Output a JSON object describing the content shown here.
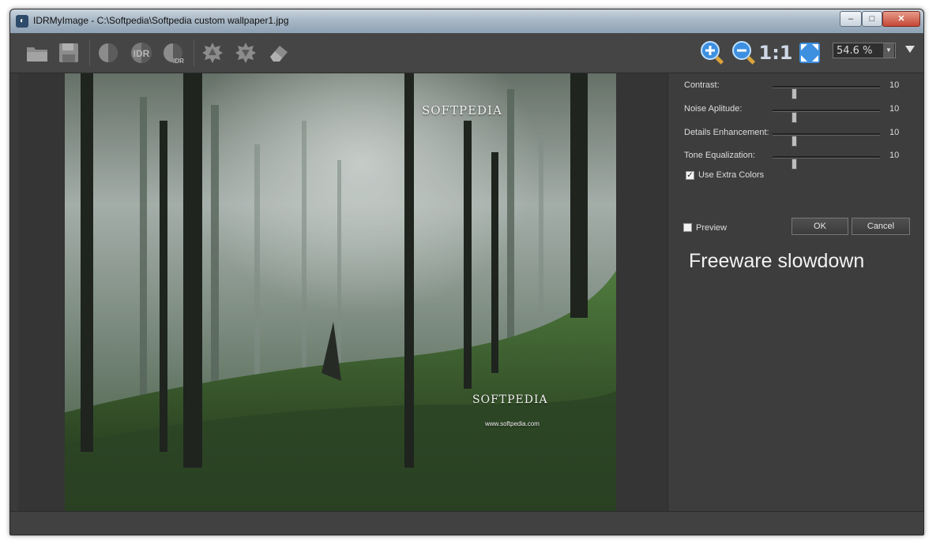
{
  "window": {
    "title": "IDRMyImage - C:\\Softpedia\\Softpedia custom wallpaper1.jpg",
    "minimize_label": "‒",
    "maximize_label": "□",
    "close_label": "✕"
  },
  "toolbar": {
    "idr_label": "IDR",
    "idr_small_label": "IDR",
    "one_to_one_label": "1:1",
    "zoom_value": "54.6 %"
  },
  "photo": {
    "watermark_top": "SOFTPEDIA",
    "watermark_mid": "SOFTPEDIA",
    "watermark_url": "www.softpedia.com"
  },
  "panel": {
    "sliders": [
      {
        "label": "Contrast:",
        "value": "10",
        "level": 0.2
      },
      {
        "label": "Noise Aplitude:",
        "value": "10",
        "level": 0.2
      },
      {
        "label": "Details Enhancement:",
        "value": "10",
        "level": 0.2
      },
      {
        "label": "Tone Equalization:",
        "value": "10",
        "level": 0.2
      }
    ],
    "use_extra_colors_label": "Use Extra Colors",
    "use_extra_colors_checked": true,
    "preview_label": "Preview",
    "preview_checked": false,
    "ok_label": "OK",
    "cancel_label": "Cancel",
    "notice": "Freeware slowdown"
  },
  "colors": {
    "window_bg": "#3a3a3a",
    "panel_bg": "#3d3d3d",
    "icon_gray": "#8a8a8a",
    "zoom_icon_blue": "#3d8fe0"
  }
}
